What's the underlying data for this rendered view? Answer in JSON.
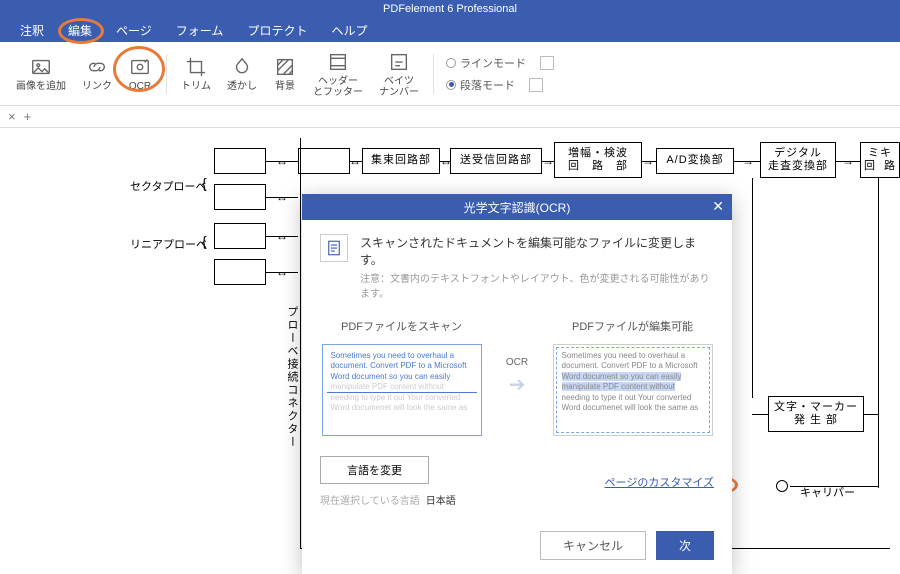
{
  "app_title": "PDFelement 6 Professional",
  "menu": [
    "注釈",
    "編集",
    "ページ",
    "フォーム",
    "プロテクト",
    "ヘルプ"
  ],
  "ribbon": {
    "add_image": "画像を追加",
    "link": "リンク",
    "ocr": "OCR",
    "trim": "トリム",
    "watermark": "透かし",
    "background": "背景",
    "header_footer": "ヘッダー\nとフッター",
    "bates": "ベイツ\nナンバー",
    "line_mode": "ラインモード",
    "paragraph_mode": "段落モード"
  },
  "tabs": {
    "close": "×",
    "add": "+"
  },
  "diagram": {
    "sector_probe": "セクタプローベ",
    "linear_probe": "リニアプローベ",
    "probe_connector": "プローベ接続コネクター",
    "focus_circuit": "集束回路部",
    "tx_rx_circuit": "送受信回路部",
    "amp_detect": "増幅・検波\n回　路　部",
    "ad_convert": "A/D変換部",
    "digital_scan": "デジタル\n走査変換部",
    "mixer": "ミキ\n回  路",
    "char_marker": "文字・マーカー\n発 生 部",
    "caliper": "キャリパー"
  },
  "dialog": {
    "title": "光学文字認識(OCR)",
    "intro_main": "スキャンされたドキュメントを編集可能なファイルに変更します。",
    "intro_sub": "注意：文書内のテキストフォントやレイアウト、色が変更される可能性があります。",
    "left_head": "PDFファイルをスキャン",
    "right_head": "PDFファイルが編集可能",
    "ocr_label": "OCR",
    "sample_l1": "Sometimes you need to overhaul a",
    "sample_l2": "document. Convert PDF to a Microsoft",
    "sample_l3": "Word document so you can easily",
    "sample_l4": "manipulate PDF content without",
    "sample_l5": "needing to type it out Your converted",
    "sample_l6": "Word documenet will look the same as",
    "change_lang": "言語を変更",
    "current_lang_label": "現在選択している言語",
    "current_lang_value": "日本語",
    "customize_link": "ページのカスタマイズ",
    "cancel": "キャンセル",
    "next": "次"
  }
}
